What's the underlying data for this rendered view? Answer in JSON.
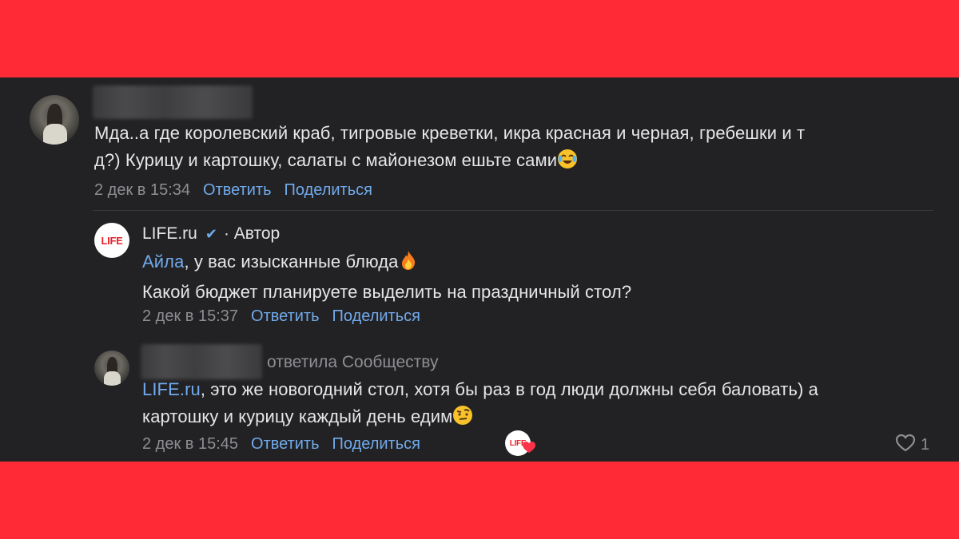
{
  "comments": [
    {
      "text_before": "Мда..а где королевский краб, тигровые креветки, икра красная и черная, гребешки и т",
      "text_after": "д?) Курицу и картошку, салаты с майонезом ешьте сами",
      "emoji": "laughing-crying",
      "date": "2 дек в 15:34",
      "reply_label": "Ответить",
      "share_label": "Поделиться"
    },
    {
      "author": "LIFE.ru",
      "author_role": "· Автор",
      "avatar_text": "LIFE",
      "mention": "Айла",
      "text_line1": ", у вас изысканные блюда",
      "emoji": "fire",
      "text_line2": "Какой бюджет планируете выделить на праздничный стол?",
      "date": "2 дек в 15:37",
      "reply_label": "Ответить",
      "share_label": "Поделиться"
    },
    {
      "reply_to": "ответила Сообществу",
      "mention": "LIFE.ru",
      "text_line1": ", это же новогодний стол, хотя бы раз в год люди должны себя баловать) а",
      "text_line2": "картошку и курицу каждый день едим",
      "emoji": "raised-eyebrow",
      "date": "2 дек в 15:45",
      "reply_label": "Ответить",
      "share_label": "Поделиться",
      "reaction_avatar_text": "LIFE",
      "likes": "1"
    }
  ],
  "colors": {
    "background_frame": "#ff2a35",
    "panel": "#222224",
    "link": "#71aaeb",
    "muted": "#8e8e93",
    "text": "#e6e6e8"
  }
}
